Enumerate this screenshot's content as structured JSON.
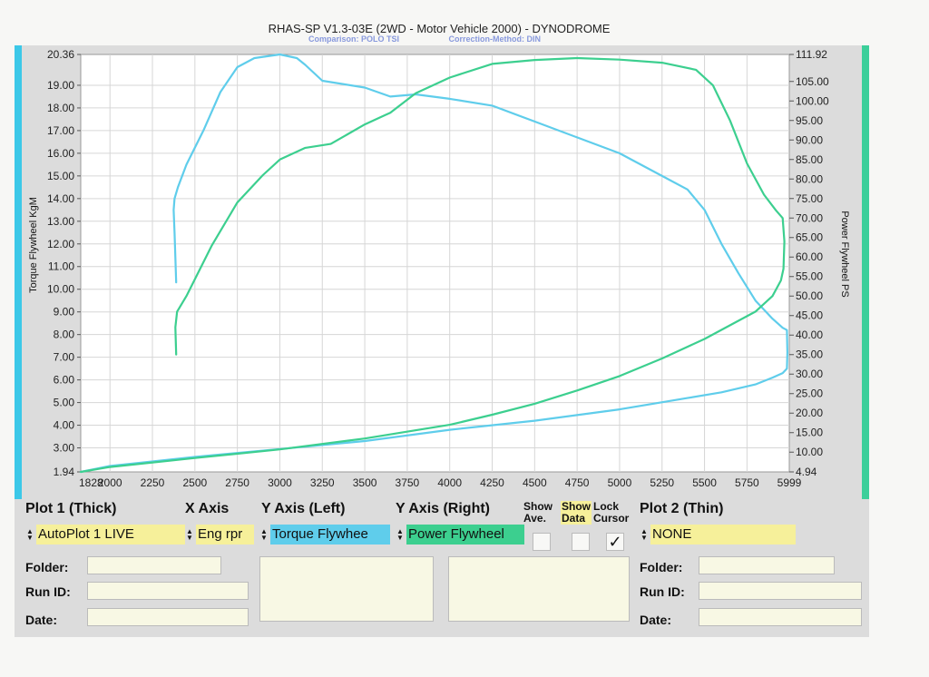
{
  "header": {
    "title": "RHAS-SP V1.3-03E  (2WD - Motor Vehicle 2000) - DYNODROME",
    "comparison": "Comparison: POLO TSI",
    "correction": "Correction-Method: DIN"
  },
  "colors": {
    "torque": "#5fcdeb",
    "power": "#3ccf8f",
    "yellow_field": "#f6f09a",
    "blue_field": "#5fcdeb",
    "green_field": "#3ccf8f",
    "left_bar": "#3cc8e8",
    "right_bar": "#3ccf9a"
  },
  "chart_data": {
    "type": "line",
    "xlim": [
      1828,
      5999
    ],
    "x_ticks": [
      "1828",
      "2000",
      "2250",
      "2500",
      "2750",
      "3000",
      "3250",
      "3500",
      "3750",
      "4000",
      "4250",
      "4500",
      "4750",
      "5000",
      "5250",
      "5500",
      "5750",
      "5999"
    ],
    "ylabel": "Torque Flywheel KgM",
    "ylim": [
      1.94,
      20.36
    ],
    "y_ticks": [
      "1.94",
      "3.00",
      "4.00",
      "5.00",
      "6.00",
      "7.00",
      "8.00",
      "9.00",
      "10.00",
      "11.00",
      "12.00",
      "13.00",
      "14.00",
      "15.00",
      "16.00",
      "17.00",
      "18.00",
      "19.00",
      "20.36"
    ],
    "y2label": "Power Flywheel PS",
    "y2lim": [
      4.94,
      111.92
    ],
    "y2_ticks": [
      "4.94",
      "10.00",
      "15.00",
      "20.00",
      "25.00",
      "30.00",
      "35.00",
      "40.00",
      "45.00",
      "50.00",
      "55.00",
      "60.00",
      "65.00",
      "70.00",
      "75.00",
      "80.00",
      "85.00",
      "90.00",
      "95.00",
      "100.00",
      "105.00",
      "111.92"
    ],
    "grid": true,
    "series": [
      {
        "name": "Torque Flywheel",
        "axis": "left",
        "x": [
          2390,
          2380,
          2375,
          2380,
          2400,
          2450,
          2550,
          2650,
          2750,
          2850,
          3000,
          3100,
          3150,
          3250,
          3500,
          3650,
          3800,
          4000,
          4250,
          4500,
          4750,
          5000,
          5250,
          5400,
          5500,
          5600,
          5700,
          5800,
          5900,
          5960,
          5985,
          5988,
          5985,
          5960,
          5900,
          5800,
          5600,
          5400,
          5200,
          5000,
          4800,
          4500,
          4000,
          3500,
          3000,
          2500,
          2000,
          1828
        ],
        "y": [
          10.3,
          12.5,
          13.5,
          14.0,
          14.5,
          15.5,
          17.0,
          18.7,
          19.8,
          20.2,
          20.36,
          20.2,
          19.9,
          19.2,
          18.9,
          18.5,
          18.6,
          18.4,
          18.1,
          17.4,
          16.7,
          16.0,
          15.0,
          14.4,
          13.5,
          12.0,
          10.7,
          9.5,
          8.7,
          8.3,
          8.2,
          7.2,
          6.5,
          6.3,
          6.1,
          5.8,
          5.45,
          5.2,
          4.95,
          4.7,
          4.5,
          4.2,
          3.8,
          3.3,
          2.95,
          2.6,
          2.2,
          1.94
        ]
      },
      {
        "name": "Power Flywheel",
        "axis": "right",
        "x": [
          2390,
          2385,
          2395,
          2450,
          2600,
          2750,
          2900,
          3000,
          3150,
          3300,
          3500,
          3650,
          3800,
          4000,
          4250,
          4500,
          4750,
          5000,
          5250,
          5450,
          5550,
          5650,
          5750,
          5850,
          5920,
          5960,
          5970,
          5965,
          5950,
          5900,
          5800,
          5500,
          5250,
          5000,
          4750,
          4500,
          4250,
          4000,
          3500,
          3000,
          2500,
          2000,
          1828
        ],
        "y": [
          35.0,
          42.0,
          46.0,
          50.0,
          63.0,
          74.0,
          81.0,
          85.0,
          88.0,
          89.0,
          94.0,
          97.0,
          102.0,
          106.0,
          109.5,
          110.5,
          111.0,
          110.6,
          109.8,
          108.0,
          104.0,
          95.0,
          84.0,
          76.0,
          72.0,
          70.0,
          64.0,
          57.0,
          54.0,
          50.0,
          46.0,
          39.0,
          34.0,
          29.5,
          25.8,
          22.4,
          19.6,
          17.0,
          13.5,
          10.7,
          8.5,
          6.2,
          4.94
        ]
      }
    ]
  },
  "panel": {
    "plot1": {
      "label": "Plot 1 (Thick)",
      "value": "AutoPlot 1 LIVE"
    },
    "xaxis": {
      "label": "X Axis",
      "value": "Eng rpr"
    },
    "yleft": {
      "label": "Y Axis (Left)",
      "value": "Torque Flywhee"
    },
    "yright": {
      "label": "Y Axis (Right)",
      "value": "Power Flywheel"
    },
    "show_ave": {
      "line1": "Show",
      "line2": "Ave.",
      "checked": false
    },
    "show_data": {
      "line1": "Show",
      "line2": "Data",
      "checked": false
    },
    "lock_cursor": {
      "line1": "Lock",
      "line2": "Cursor",
      "checked": true,
      "mark": "✓"
    },
    "plot2": {
      "label": "Plot 2 (Thin)",
      "value": "NONE"
    },
    "folder_label": "Folder:",
    "runid_label": "Run ID:",
    "date_label": "Date:",
    "arrows": "▲▼"
  }
}
